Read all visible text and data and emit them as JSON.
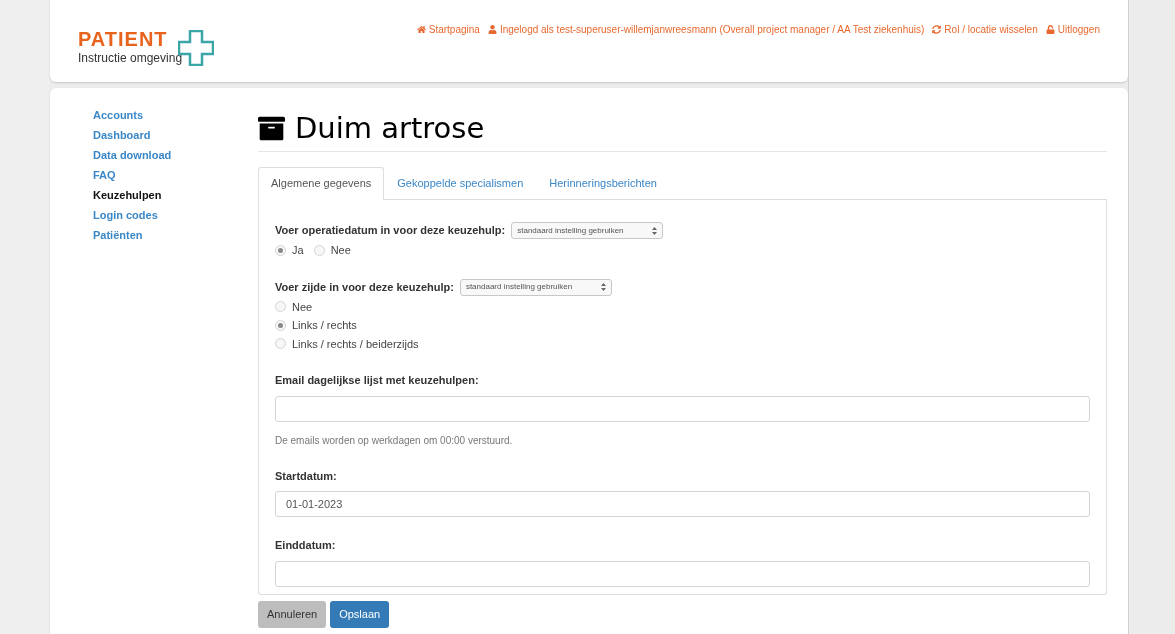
{
  "header": {
    "logo": {
      "brand": "PATIENT",
      "subtitle": "Instructie omgeving"
    },
    "links": [
      {
        "kind": "home",
        "label": "Startpagina"
      },
      {
        "kind": "user",
        "label": "Ingelogd als test-superuser-willemjanwreesmann (Overall project manager / AA Test ziekenhuis)"
      },
      {
        "kind": "refresh",
        "label": "Rol / locatie wisselen"
      },
      {
        "kind": "unlock",
        "label": "Uitloggen"
      }
    ]
  },
  "sidebar": {
    "items": [
      {
        "label": "Accounts",
        "selected": false
      },
      {
        "label": "Dashboard",
        "selected": false
      },
      {
        "label": "Data download",
        "selected": false
      },
      {
        "label": "FAQ",
        "selected": false
      },
      {
        "label": "Keuzehulpen",
        "selected": true
      },
      {
        "label": "Login codes",
        "selected": false
      },
      {
        "label": "Patiënten",
        "selected": false
      }
    ]
  },
  "page": {
    "title": "Duim artrose"
  },
  "tabs": [
    {
      "label": "Algemene gegevens",
      "selected": true
    },
    {
      "label": "Gekoppelde specialismen",
      "selected": false
    },
    {
      "label": "Herinneringsberichten",
      "selected": false
    }
  ],
  "form": [
    {
      "kind": "inline_choice",
      "label": "Voer operatiedatum in voor deze keuzehulp:",
      "select": "standaard instelling gebruiken",
      "options": [
        {
          "label": "Ja",
          "selected": true
        },
        {
          "label": "Nee",
          "selected": false
        }
      ]
    },
    {
      "kind": "stacked_choice",
      "label": "Voer zijde in voor deze keuzehulp:",
      "select": "standaard instelling gebruiken",
      "options": [
        {
          "label": "Nee",
          "selected": false
        },
        {
          "label": "Links / rechts",
          "selected": true
        },
        {
          "label": "Links / rechts / beiderzijds",
          "selected": false
        }
      ]
    },
    {
      "kind": "text",
      "label": "Email dagelijkse lijst met keuzehulpen:",
      "help": "De emails worden op werkdagen om 00:00 verstuurd."
    },
    {
      "kind": "text",
      "label": "Startdatum:",
      "value": "01-01-2023"
    },
    {
      "kind": "text",
      "label": "Einddatum:"
    }
  ],
  "buttons": [
    {
      "kind": "secondary",
      "label": "Annuleren"
    },
    {
      "kind": "primary",
      "label": "Opslaan"
    }
  ]
}
